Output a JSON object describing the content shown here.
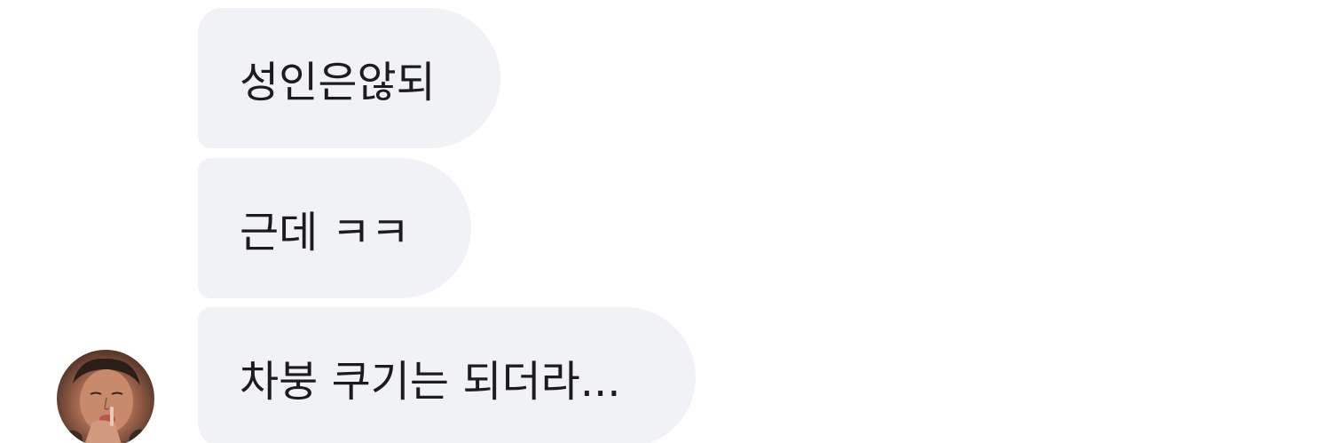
{
  "messages": [
    {
      "text": "성인은않되"
    },
    {
      "text": "근데 ㅋㅋ"
    },
    {
      "text": "차붕 쿠기는 되더라..."
    }
  ],
  "colors": {
    "bubble_bg": "#f1f2f6",
    "text": "#1c1c1e",
    "background": "#ffffff"
  },
  "icons": {
    "sender_avatar": "profile-photo"
  }
}
